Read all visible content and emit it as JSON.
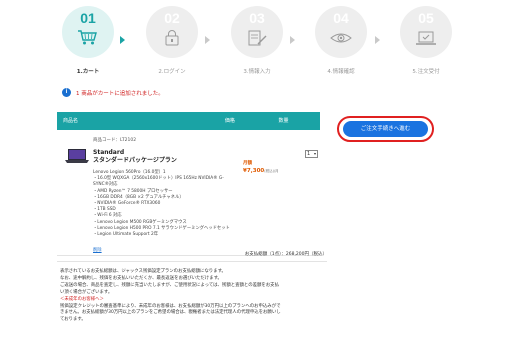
{
  "steps": [
    {
      "num": "01",
      "label": "1.カート",
      "icon": "cart-icon",
      "active": true
    },
    {
      "num": "02",
      "label": "2.ログイン",
      "icon": "lock-icon",
      "active": false
    },
    {
      "num": "03",
      "label": "3.情報入力",
      "icon": "form-pen-icon",
      "active": false
    },
    {
      "num": "04",
      "label": "4.情報確認",
      "icon": "eye-icon",
      "active": false
    },
    {
      "num": "05",
      "label": "5.注文受付",
      "icon": "laptop-check-icon",
      "active": false
    }
  ],
  "notice": {
    "icon_text": "i",
    "text": "1 商品がカートに追加されました。"
  },
  "table": {
    "headers": {
      "name": "商品名",
      "price": "価格",
      "qty": "数量"
    },
    "item": {
      "code": "商品コード：LT2102",
      "name_line1": "Standard",
      "name_line2": "スタンダードパッケージプラン",
      "specs": [
        "Lenovo Legion 560Pro（16.0型）1",
        "・16.0型 WQXGA（2560x1600ドット）IPS 165Hz NVIDIA® G-",
        "SYNC®対応",
        "・AMD Ryzen™ 7 5800H プロセッサー",
        "・16GB DDR4（8GB ×2 デュアルチャネル）",
        "・NVIDIA® GeForce® RTX3060",
        "・1TB SSD",
        "・Wi-Fi 6 対応",
        "・Lenovo Legion M500 RGBゲーミングマウス",
        "・Lenovo Legion H500 PRO 7.1 サラウンドゲーミングヘッドセット",
        "・Legion Ultimate Support 2年"
      ],
      "delete_label": "削除",
      "price_tag": "月額",
      "price": "¥7,300",
      "price_note": "(税込)/月",
      "qty": "1"
    },
    "total": "お支払総額（1点）：268,200円（税込）"
  },
  "checkout_button": "ご注文手続きへ進む",
  "notes": [
    "表示されているお支払総額は、ジャックス残価設定プランのお支払総額になります。",
    "なお、途中解約し、残価をお支払いいただくか、最長返送をお選びいただけます。",
    "ご返送の場合、商品を査定し、残額に充当いたしますが、ご使用状況によっては、残額と査額との差額をお支払",
    "い頂く場合がございます。"
  ],
  "warning_head": "＜未成年のお客様へ＞",
  "warning_lines": [
    "残価設定クレジットの審査基準により、未成年のお客様は、お支払総額が30万円以上のプランへのお申込みがで",
    "きません。お支払総額が30万円以上のプランをご希望の場合は、親権者または法定代理人の代理申込をお願いし",
    "ております。"
  ],
  "colors": {
    "teal": "#1aa3a5",
    "blue": "#1a73e0",
    "red": "#e02020",
    "orange": "#e05a00"
  }
}
